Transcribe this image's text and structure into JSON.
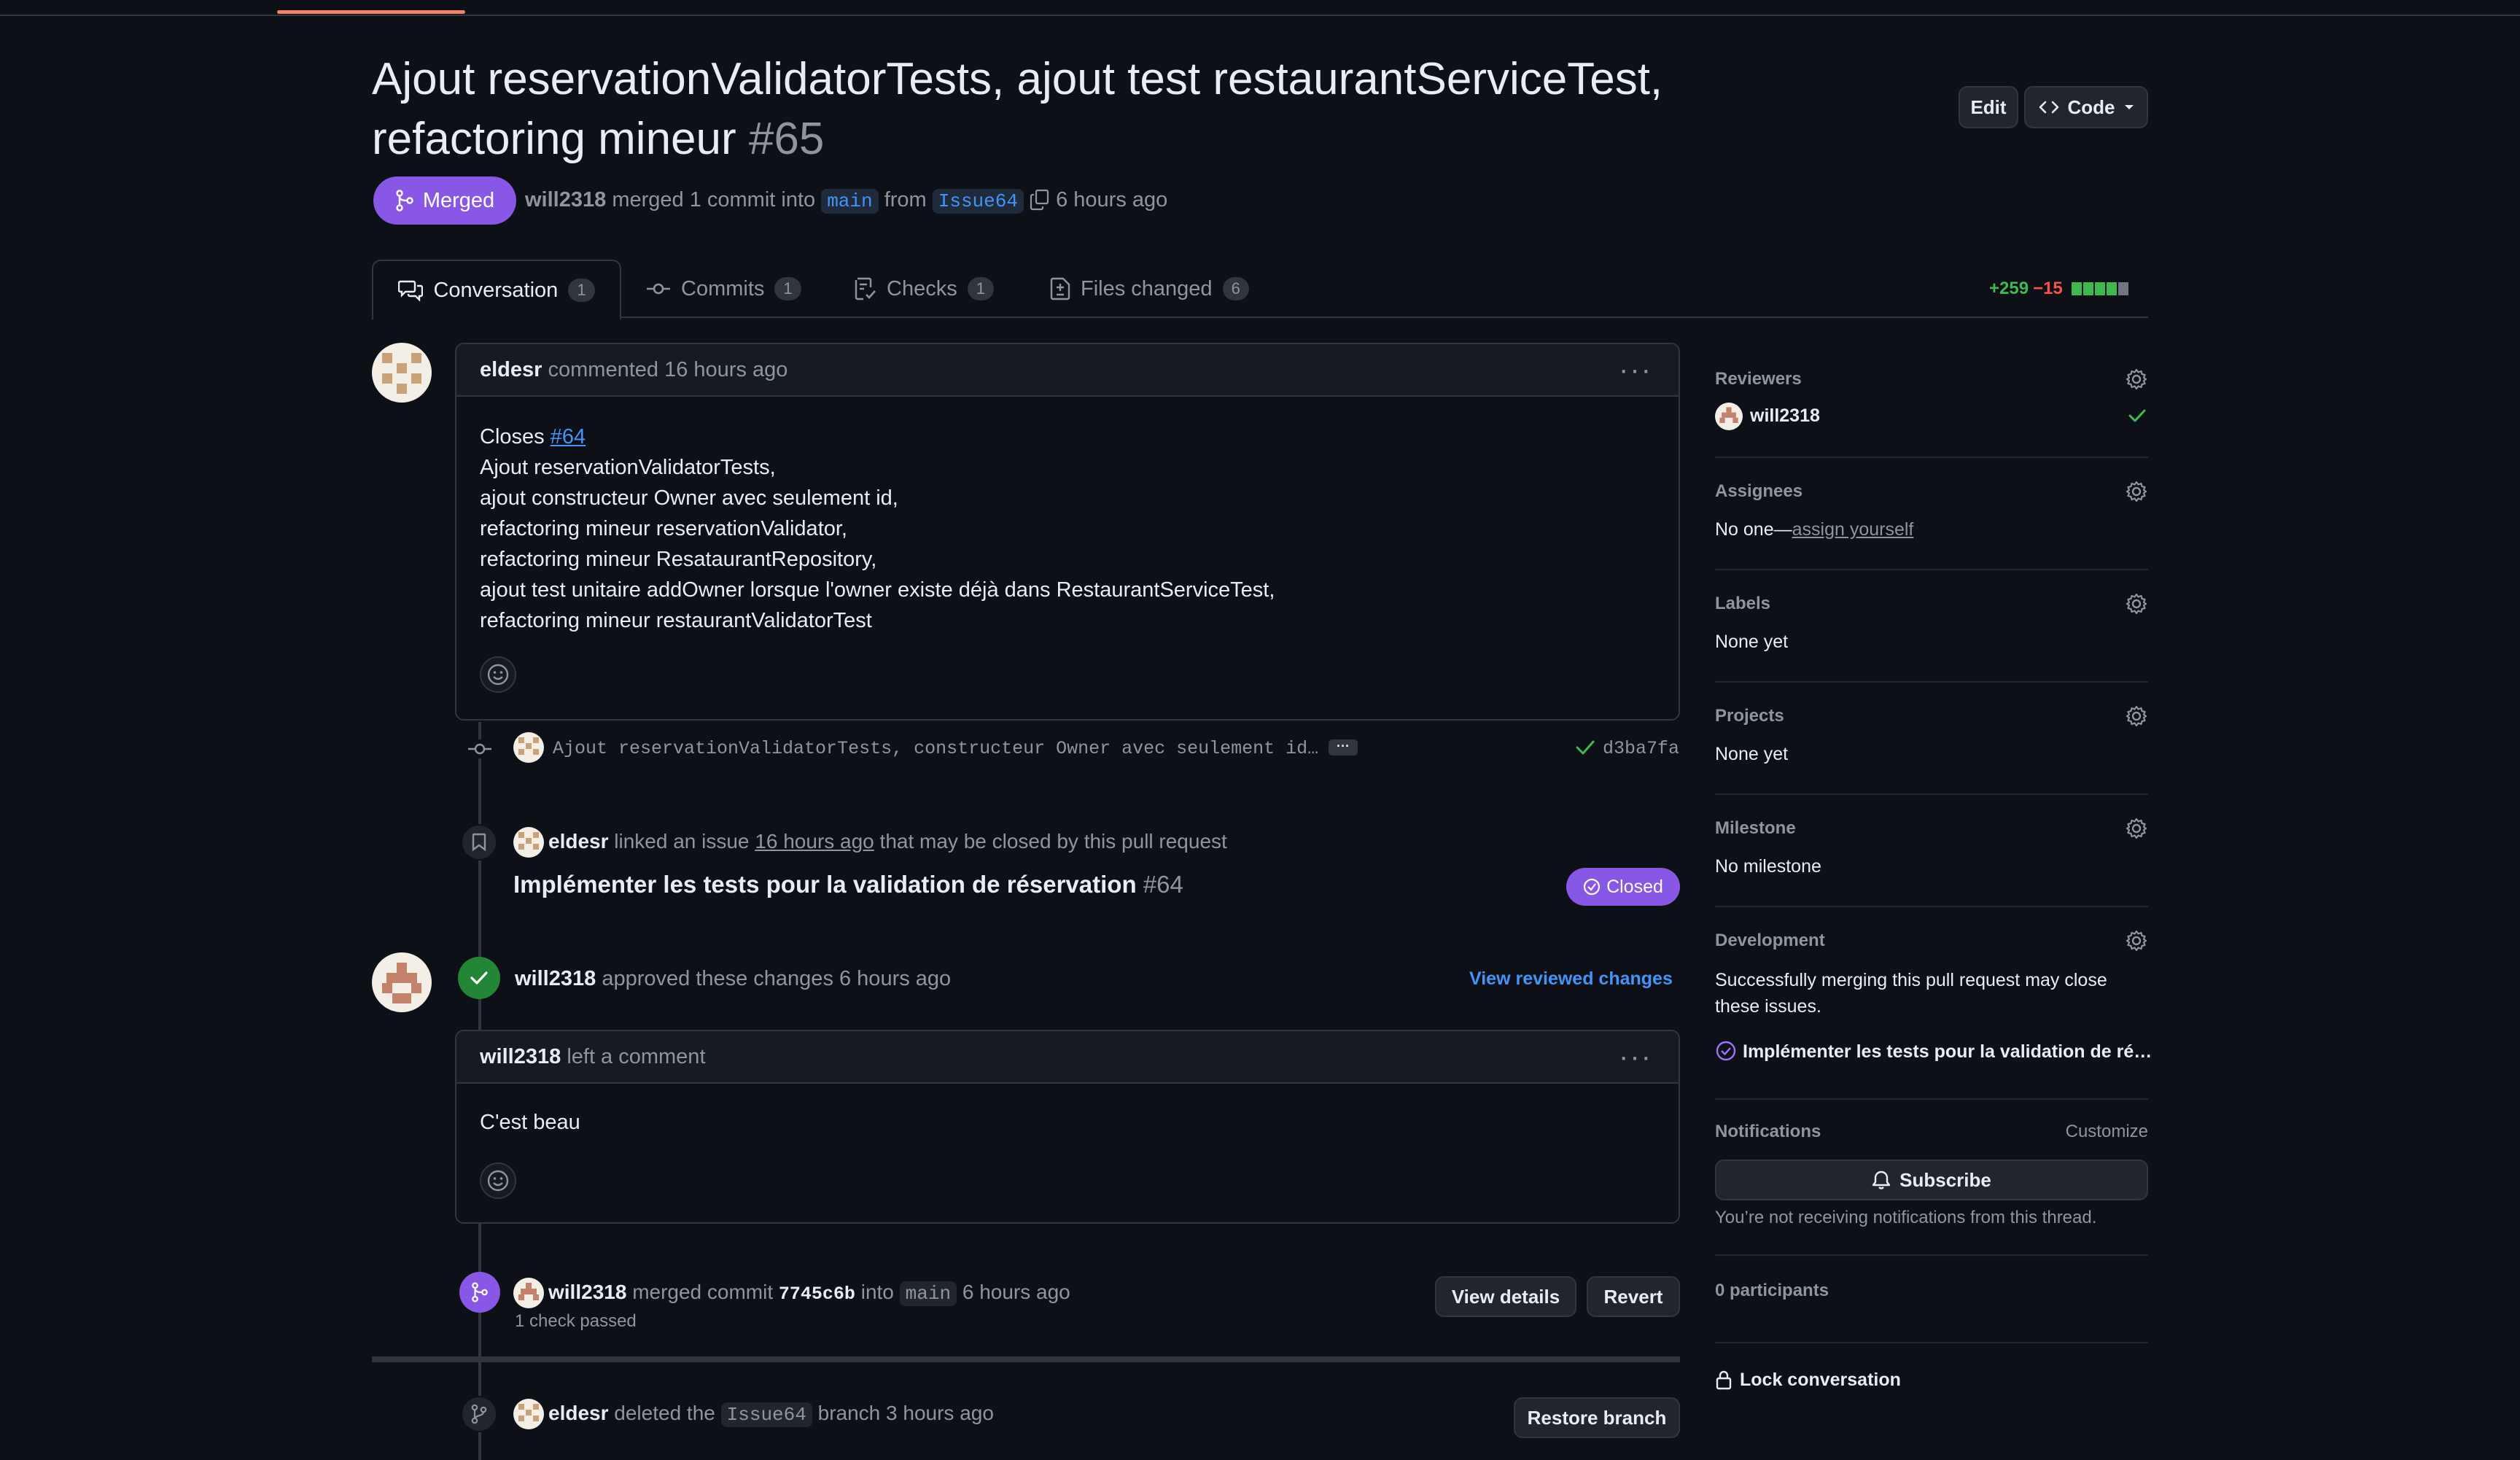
{
  "header": {
    "title": "Ajout reservationValidatorTests, ajout test restaurantServiceTest, refactoring mineur",
    "number": "#65",
    "edit_label": "Edit",
    "code_label": "Code",
    "status_label": "Merged",
    "author": "will2318",
    "merged_text": "merged 1 commit into",
    "base_branch": "main",
    "from_text": "from",
    "head_branch": "Issue64",
    "time": "6 hours ago"
  },
  "tabs": [
    {
      "label": "Conversation",
      "count": "1"
    },
    {
      "label": "Commits",
      "count": "1"
    },
    {
      "label": "Checks",
      "count": "1"
    },
    {
      "label": "Files changed",
      "count": "6"
    }
  ],
  "diffstat": {
    "additions": "+259",
    "deletions": "−15"
  },
  "comment1": {
    "author": "eldesr",
    "meta": "commented 16 hours ago",
    "closes_prefix": "Closes",
    "closes_ref": "#64",
    "lines": [
      "Ajout reservationValidatorTests,",
      "ajout constructeur Owner avec seulement id,",
      "refactoring mineur reservationValidator,",
      "refactoring mineur ResataurantRepository,",
      "ajout test unitaire addOwner lorsque l'owner existe déjà dans RestaurantServiceTest,",
      "refactoring mineur restaurantValidatorTest"
    ]
  },
  "commit": {
    "message": "Ajout reservationValidatorTests, constructeur Owner avec seulement id…",
    "ellipsis": "···",
    "sha": "d3ba7fa"
  },
  "linked_issue": {
    "author": "eldesr",
    "text_before": "linked an issue",
    "time": "16 hours ago",
    "text_after": "that may be closed by this pull request",
    "issue_title": "Implémenter les tests pour la validation de réservation",
    "issue_number": "#64",
    "closed_label": "Closed"
  },
  "review": {
    "author": "will2318",
    "text": "approved these changes 6 hours ago",
    "view_link": "View reviewed changes",
    "comment_author": "will2318",
    "comment_meta": "left a comment",
    "comment_body": "C'est beau"
  },
  "merge_event": {
    "author": "will2318",
    "text": "merged commit",
    "sha": "7745c6b",
    "into": "into",
    "branch": "main",
    "time": "6 hours ago",
    "checks": "1 check passed",
    "view_details": "View details",
    "revert": "Revert"
  },
  "delete_event": {
    "author": "eldesr",
    "text": "deleted the",
    "branch": "Issue64",
    "text_after": "branch 3 hours ago",
    "restore": "Restore branch"
  },
  "sidebar": {
    "reviewers_label": "Reviewers",
    "reviewer": "will2318",
    "assignees_label": "Assignees",
    "assignees_none": "No one—",
    "assign_yourself": "assign yourself",
    "labels_label": "Labels",
    "labels_value": "None yet",
    "projects_label": "Projects",
    "projects_value": "None yet",
    "milestone_label": "Milestone",
    "milestone_value": "No milestone",
    "development_label": "Development",
    "development_text": "Successfully merging this pull request may close these issues.",
    "development_issue": "Implémenter les tests pour la validation de ré…",
    "notifications_label": "Notifications",
    "customize": "Customize",
    "subscribe": "Subscribe",
    "notif_text": "You’re not receiving notifications from this thread.",
    "participants": "0 participants",
    "lock": "Lock conversation"
  },
  "colors": {
    "merged": "#8957e5",
    "success": "#3fb950",
    "danger": "#f85149",
    "link": "#4493f8"
  }
}
